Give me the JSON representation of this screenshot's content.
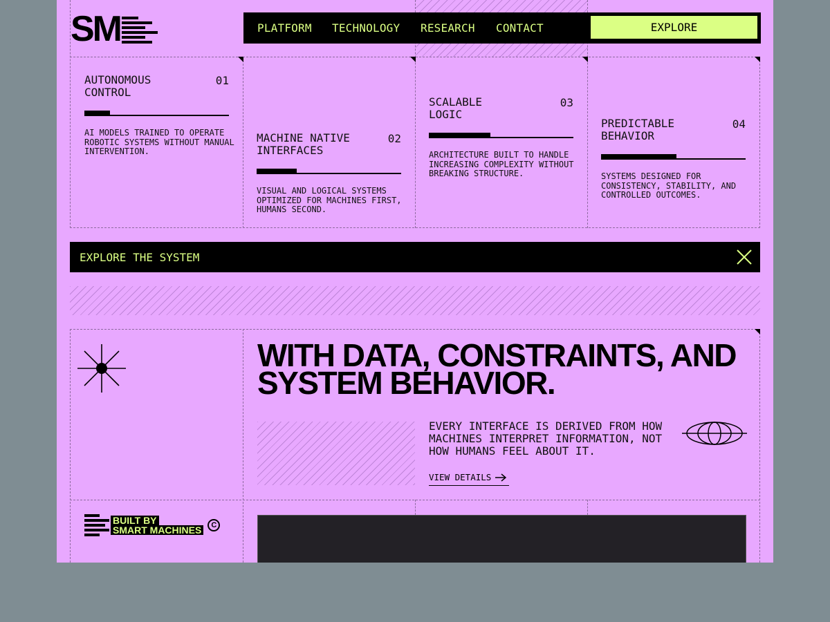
{
  "logo": {
    "text": "SM"
  },
  "nav": {
    "items": [
      "PLATFORM",
      "TECHNOLOGY",
      "RESEARCH",
      "CONTACT"
    ],
    "cta": "EXPLORE"
  },
  "cards": [
    {
      "title": "AUTONOMOUS CONTROL",
      "num": "01",
      "desc": "AI MODELS TRAINED TO OPERATE ROBOTIC SYSTEMS WITHOUT MANUAL INTERVENTION."
    },
    {
      "title": "MACHINE NATIVE INTERFACES",
      "num": "02",
      "desc": "VISUAL AND LOGICAL SYSTEMS OPTIMIZED FOR MACHINES FIRST, HUMANS SECOND."
    },
    {
      "title": "SCALABLE LOGIC",
      "num": "03",
      "desc": "ARCHITECTURE BUILT TO HANDLE INCREASING COMPLEXITY WITHOUT BREAKING STRUCTURE."
    },
    {
      "title": "PREDICTABLE BEHAVIOR",
      "num": "04",
      "desc": "SYSTEMS DESIGNED FOR CONSISTENCY, STABILITY, AND CONTROLLED OUTCOMES."
    }
  ],
  "banner": {
    "text": "EXPLORE THE SYSTEM"
  },
  "hero": {
    "headline": "WITH DATA, CONSTRAINTS, AND SYSTEM BEHAVIOR.",
    "body": "EVERY INTERFACE IS DERIVED FROM HOW MACHINES INTERPRET INFORMATION, NOT HOW HUMANS FEEL ABOUT IT.",
    "link": "VIEW DETAILS"
  },
  "footer": {
    "built_line1": "BUILT BY",
    "built_line2": "SMART MACHINES",
    "copyright": "C"
  },
  "colors": {
    "page_bg": "#e8a8ff",
    "outer_bg": "#7f8d93",
    "accent": "#dbff84",
    "ink": "#000000"
  }
}
